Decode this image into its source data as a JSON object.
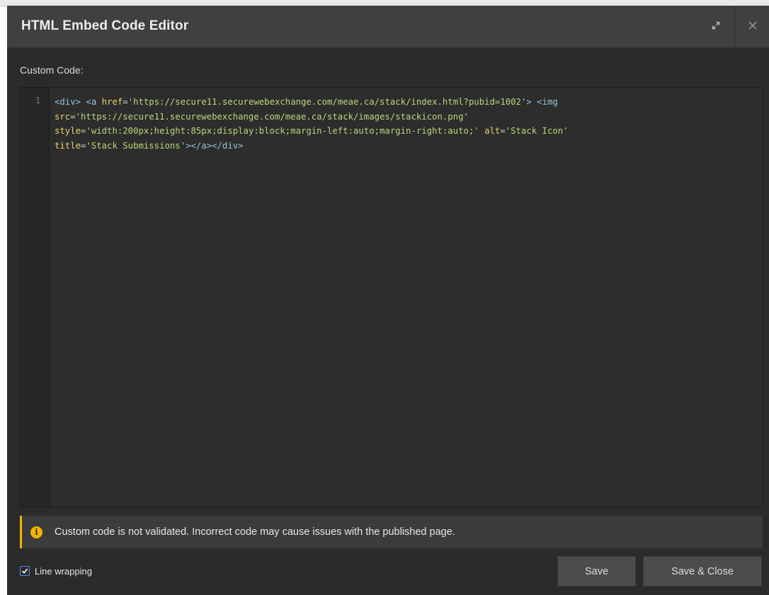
{
  "dialog": {
    "title": "HTML Embed Code Editor",
    "icons": {
      "expand": "expand-icon",
      "close": "close-icon"
    }
  },
  "editor": {
    "label": "Custom Code:",
    "line_number": "1",
    "line_wrapping_enabled": true,
    "code_lines": [
      [
        {
          "t": "tag",
          "v": "<div>"
        },
        {
          "t": "op",
          "v": " "
        },
        {
          "t": "tag",
          "v": "<a"
        },
        {
          "t": "op",
          "v": " "
        },
        {
          "t": "attr",
          "v": "href"
        },
        {
          "t": "op",
          "v": "="
        },
        {
          "t": "str",
          "v": "'https://secure11.securewebexchange.com/meae.ca/stack/index.html?pubid=1002'"
        },
        {
          "t": "tag",
          "v": ">"
        },
        {
          "t": "op",
          "v": " "
        },
        {
          "t": "tag",
          "v": "<img"
        }
      ],
      [
        {
          "t": "attr",
          "v": "src"
        },
        {
          "t": "op",
          "v": "="
        },
        {
          "t": "str",
          "v": "'https://secure11.securewebexchange.com/meae.ca/stack/images/stackicon.png'"
        }
      ],
      [
        {
          "t": "attr",
          "v": "style"
        },
        {
          "t": "op",
          "v": "="
        },
        {
          "t": "str",
          "v": "'width:200px;height:85px;display:block;margin-left:auto;margin-right:auto;'"
        },
        {
          "t": "op",
          "v": " "
        },
        {
          "t": "attr",
          "v": "alt"
        },
        {
          "t": "op",
          "v": "="
        },
        {
          "t": "str",
          "v": "'Stack Icon'"
        }
      ],
      [
        {
          "t": "attr",
          "v": "title"
        },
        {
          "t": "op",
          "v": "="
        },
        {
          "t": "str",
          "v": "'Stack Submissions'"
        },
        {
          "t": "tag",
          "v": "></a></div>"
        }
      ]
    ]
  },
  "notice": {
    "icon": "info-icon",
    "text": "Custom code is not validated. Incorrect code may cause issues with the published page."
  },
  "footer": {
    "line_wrapping_label": "Line wrapping",
    "save_label": "Save",
    "save_close_label": "Save & Close"
  },
  "colors": {
    "accent": "#4a90e2",
    "warning": "#f2b400",
    "dialog_bg": "#2b2b2b",
    "titlebar_bg": "#404040",
    "button_bg": "#4c4c4c"
  }
}
